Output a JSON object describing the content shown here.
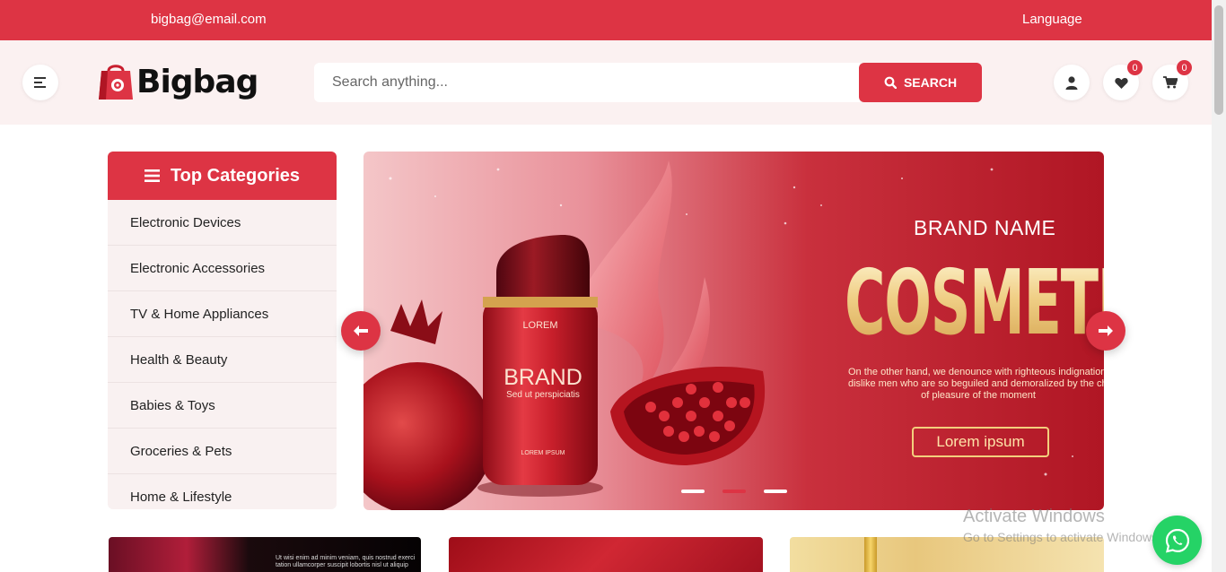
{
  "topbar": {
    "email": "bigbag@email.com",
    "language": "Language"
  },
  "header": {
    "logo_text": "Bigbag",
    "search": {
      "placeholder": "Search anything...",
      "button_label": "SEARCH"
    },
    "wishlist_count": "0",
    "cart_count": "0"
  },
  "categories": {
    "title": "Top Categories",
    "items": [
      {
        "label": "Electronic Devices"
      },
      {
        "label": "Electronic Accessories"
      },
      {
        "label": "TV & Home Appliances"
      },
      {
        "label": "Health & Beauty"
      },
      {
        "label": "Babies & Toys"
      },
      {
        "label": "Groceries & Pets"
      },
      {
        "label": "Home & Lifestyle"
      }
    ]
  },
  "banner": {
    "brand_name": "BRAND NAME",
    "headline": "COSMETIC",
    "description_lines": [
      "On the other hand, we denounce with righteous indignation and",
      "dislike men who are so beguiled and demoralized by the charms",
      "of pleasure of the moment"
    ],
    "button_label": "Lorem ipsum",
    "product": {
      "top_text": "LOREM",
      "brand": "BRAND",
      "tagline": "Sed ut perspiciatis",
      "bottom_text": "LOREM IPSUM"
    },
    "active_slide": 2,
    "slide_count": 3
  },
  "promo1_text": [
    "Ut wisi enim ad minim veniam, quis nostrud exerci",
    "tation ullamcorper suscipit lobortis nisl ut aliquip"
  ],
  "watermark": {
    "title": "Activate Windows",
    "subtitle": "Go to Settings to activate Windows."
  },
  "colors": {
    "accent": "#dd3444",
    "header_bg": "#fbf1f1",
    "whatsapp": "#25d366"
  },
  "icons": {
    "menu": "menu-icon",
    "search": "search-icon",
    "user": "user-icon",
    "wishlist": "heart-icon",
    "cart": "cart-icon",
    "whatsapp": "whatsapp-icon"
  }
}
